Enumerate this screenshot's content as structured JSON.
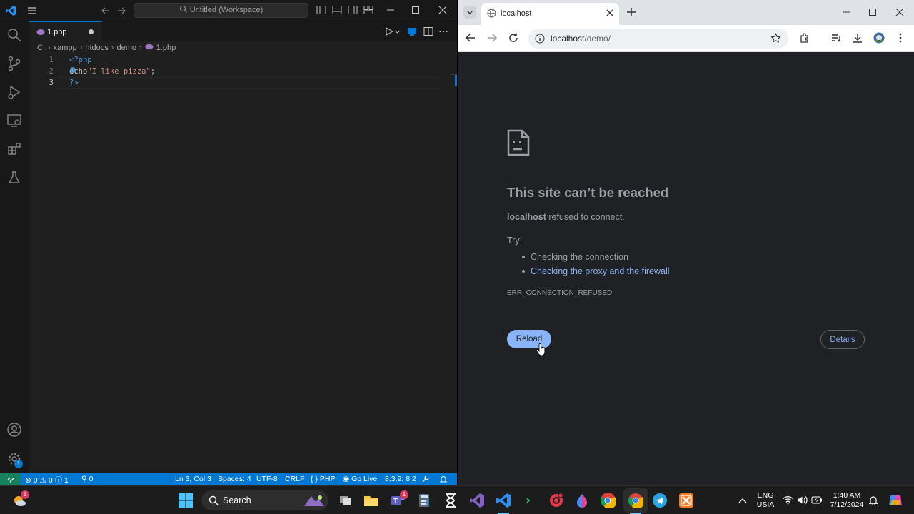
{
  "vscode": {
    "title": "Untitled (Workspace)",
    "tab": {
      "label": "1.php",
      "dirty": true
    },
    "breadcrumb": [
      "C:",
      "xampp",
      "htdocs",
      "demo",
      "1.php"
    ],
    "editor": {
      "lines": [
        {
          "number": "1",
          "text": "<?php"
        },
        {
          "number": "2",
          "keyword": "echo",
          "string": "\"I like pizza\"",
          "end": ";"
        },
        {
          "number": "3",
          "text": "?>"
        }
      ]
    },
    "status": {
      "errors": "0",
      "warnings": "0",
      "info": "1",
      "ports": "0",
      "position": "Ln 3, Col 3",
      "spaces": "Spaces: 4",
      "encoding": "UTF-8",
      "eol": "CRLF",
      "language": "PHP",
      "golive": "Go Live",
      "php_version": "8.3.9: 8.2"
    },
    "colors": {
      "accent": "#0078d4",
      "remote": "#16825d"
    }
  },
  "chrome": {
    "tab_title": "localhost",
    "url_host": "localhost",
    "url_path": "/demo/",
    "error": {
      "title": "This site can’t be reached",
      "host": "localhost",
      "desc": " refused to connect.",
      "try_label": "Try:",
      "suggestions": [
        "Checking the connection",
        "Checking the proxy and the firewall"
      ],
      "code": "ERR_CONNECTION_REFUSED",
      "reload_label": "Reload",
      "details_label": "Details"
    },
    "colors": {
      "link": "#8ab4f8",
      "background": "#202124"
    }
  },
  "taskbar": {
    "search_label": "Search",
    "lang_top": "ENG",
    "lang_bottom": "USIA",
    "time": "1:40 AM",
    "date": "7/12/2024",
    "widget_badge": "1",
    "teams_badge": "1",
    "apps": [
      "start-icon",
      "search",
      "task-view-icon",
      "file-explorer-icon",
      "teams-icon",
      "calculator-icon",
      "hourglass-icon",
      "visual-studio-icon",
      "vscode-icon",
      "terminal-icon",
      "screen-recorder-icon",
      "paint-icon",
      "chrome-icon",
      "chrome-active-icon",
      "telegram-icon",
      "xampp-icon"
    ]
  }
}
